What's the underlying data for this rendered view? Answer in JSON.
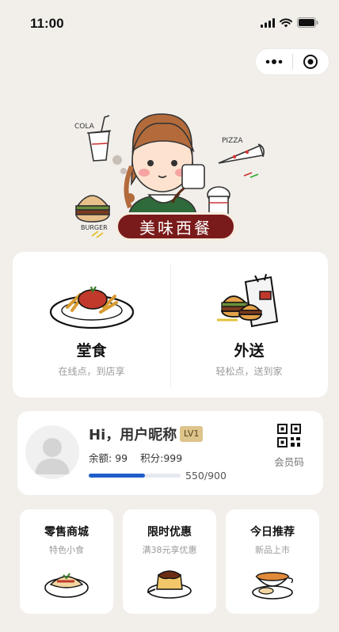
{
  "status_bar": {
    "time": "11:00"
  },
  "hero": {
    "banner_text": "美味西餐",
    "doodle_cola": "COLA",
    "doodle_pizza": "PIZZA",
    "doodle_burger": "BURGER"
  },
  "order_options": [
    {
      "title": "堂食",
      "subtitle": "在线点，到店享"
    },
    {
      "title": "外送",
      "subtitle": "轻松点，送到家"
    }
  ],
  "member": {
    "greeting": "Hi，用户昵称",
    "level": "LV1",
    "balance_label": "余额:",
    "balance_value": "99",
    "points_label": "积分:",
    "points_value": "999",
    "progress_text": "550/900",
    "progress_fraction": 0.611,
    "qr_label": "会员码"
  },
  "features": [
    {
      "title": "零售商城",
      "subtitle": "特色小食"
    },
    {
      "title": "限时优惠",
      "subtitle": "满38元享优惠"
    },
    {
      "title": "今日推荐",
      "subtitle": "新品上市"
    }
  ],
  "colors": {
    "background": "#f2efeb",
    "banner": "#7a1b1b",
    "level_badge": "#dcc48a",
    "progress": "#1f5ec9"
  },
  "icons": [
    "signal-icon",
    "wifi-icon",
    "battery-icon",
    "more-dots-icon",
    "target-circle-icon",
    "qr-code-icon",
    "avatar-placeholder-icon"
  ]
}
